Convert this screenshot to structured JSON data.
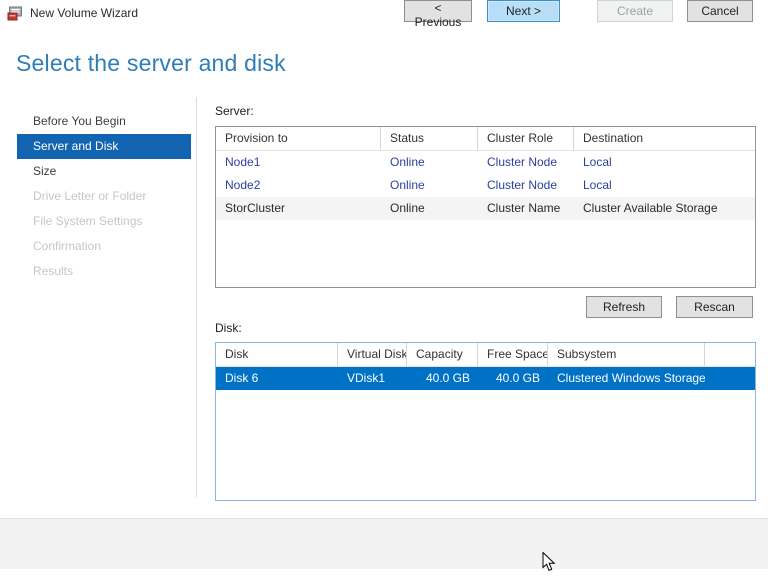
{
  "window": {
    "title": "New Volume Wizard",
    "controls": [
      {
        "name": "minimize",
        "glyph": "–"
      },
      {
        "name": "maximize",
        "glyph": "□"
      },
      {
        "name": "close",
        "glyph": "✕"
      }
    ]
  },
  "page": {
    "title": "Select the server and disk"
  },
  "sidebar": {
    "items": [
      {
        "label": "Before You Begin",
        "state": "enabled"
      },
      {
        "label": "Server and Disk",
        "state": "selected"
      },
      {
        "label": "Size",
        "state": "enabled"
      },
      {
        "label": "Drive Letter or Folder",
        "state": "disabled"
      },
      {
        "label": "File System Settings",
        "state": "disabled"
      },
      {
        "label": "Confirmation",
        "state": "disabled"
      },
      {
        "label": "Results",
        "state": "disabled"
      }
    ]
  },
  "server_section": {
    "label": "Server:",
    "table": {
      "headers": [
        "Provision to",
        "Status",
        "Cluster Role",
        "Destination"
      ],
      "aligns": [
        "left",
        "left",
        "left",
        "left"
      ],
      "rows": [
        {
          "style": "link",
          "cells": [
            "Node1",
            "Online",
            "Cluster Node",
            "Local"
          ]
        },
        {
          "style": "link",
          "cells": [
            "Node2",
            "Online",
            "Cluster Node",
            "Local"
          ]
        },
        {
          "style": "alt",
          "cells": [
            "StorCluster",
            "Online",
            "Cluster Name",
            "Cluster Available Storage"
          ]
        }
      ]
    },
    "buttons": [
      {
        "label": "Refresh"
      },
      {
        "label": "Rescan"
      }
    ]
  },
  "disk_section": {
    "label": "Disk:",
    "table": {
      "headers": [
        "Disk",
        "Virtual Disk",
        "Capacity",
        "Free Space",
        "Subsystem",
        ""
      ],
      "aligns": [
        "left",
        "left",
        "right",
        "right",
        "left",
        "left"
      ],
      "rows": [
        {
          "style": "selected",
          "cells": [
            "Disk 6",
            "VDisk1",
            "40.0 GB",
            "40.0 GB",
            "Clustered Windows Storage",
            ""
          ]
        }
      ]
    }
  },
  "footer": {
    "buttons": [
      {
        "label": "< Previous",
        "state": "normal"
      },
      {
        "label": "Next >",
        "state": "default"
      },
      {
        "label": "Create",
        "state": "disabled"
      },
      {
        "label": "Cancel",
        "state": "normal"
      }
    ]
  },
  "icons": [
    "app-icon",
    "minimize-icon",
    "maximize-icon",
    "close-icon",
    "mouse-cursor"
  ],
  "colors": {
    "accent_title": "#2e7db6",
    "sidebar_selected_bg": "#1264b0",
    "row_selected_bg": "#0072c6",
    "link_row_text": "#2b3f9e",
    "disk_table_border": "#8ab6dd",
    "next_button_bg": "#b8ddf6",
    "next_button_border": "#3e8fc9",
    "footer_bg": "#f2f2f2"
  }
}
